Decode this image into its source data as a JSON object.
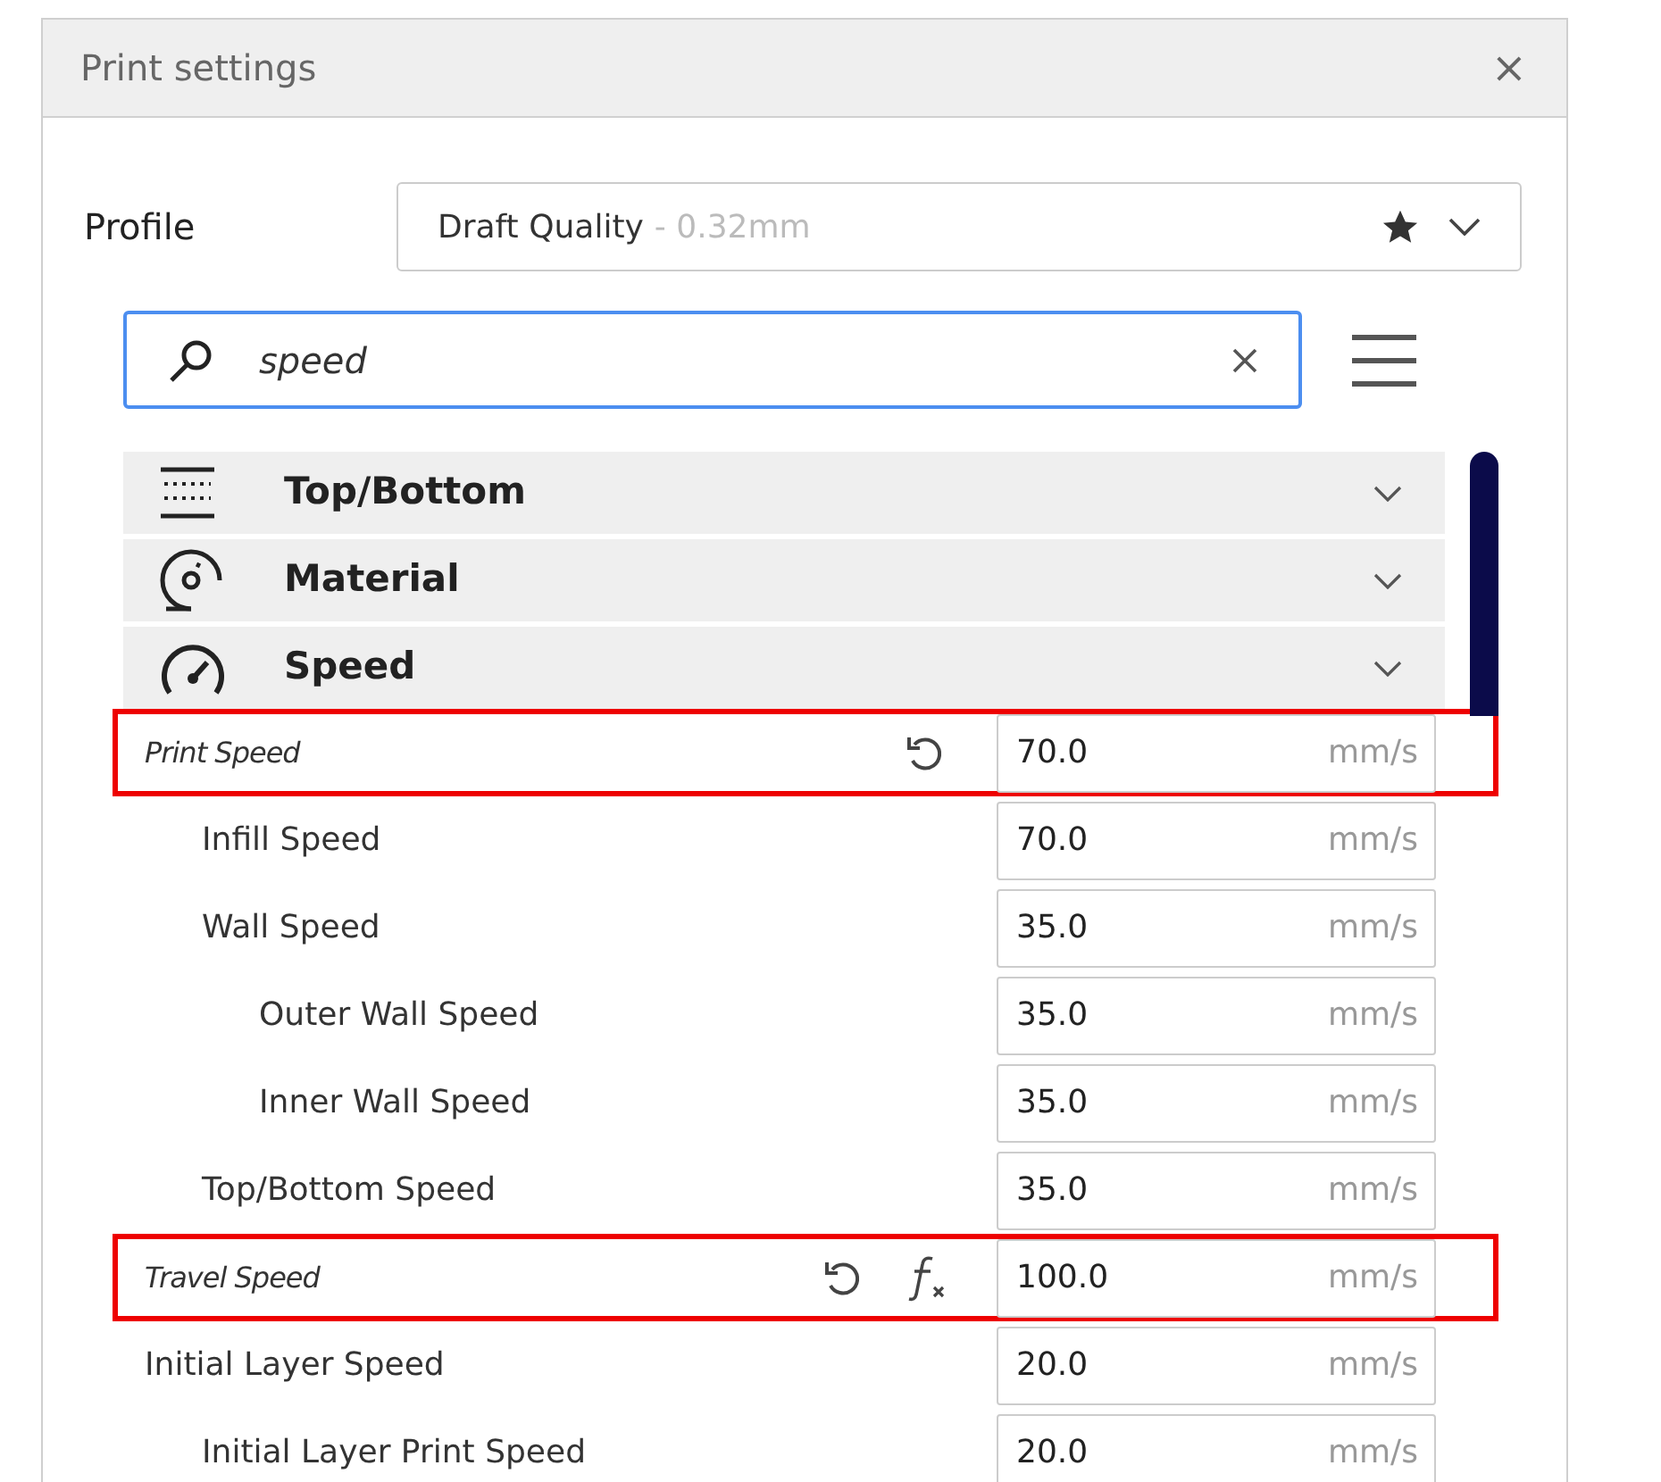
{
  "window": {
    "title": "Print settings",
    "close": "×"
  },
  "profile": {
    "label": "Profile",
    "name": "Draft Quality",
    "detail": "- 0.32mm"
  },
  "search": {
    "value": "speed"
  },
  "categories": [
    {
      "label": "Top/Bottom"
    },
    {
      "label": "Material"
    },
    {
      "label": "Speed"
    }
  ],
  "settings": [
    {
      "label": "Print Speed",
      "value": "70.0",
      "unit": "mm/s",
      "modified": true,
      "formula": false,
      "highlighted": true,
      "children": [
        {
          "label": "Infill Speed",
          "value": "70.0",
          "unit": "mm/s",
          "modified": false,
          "formula": false,
          "highlighted": false
        },
        {
          "label": "Wall Speed",
          "value": "35.0",
          "unit": "mm/s",
          "modified": false,
          "formula": false,
          "highlighted": false,
          "children": [
            {
              "label": "Outer Wall Speed",
              "value": "35.0",
              "unit": "mm/s",
              "modified": false,
              "formula": false,
              "highlighted": false
            },
            {
              "label": "Inner Wall Speed",
              "value": "35.0",
              "unit": "mm/s",
              "modified": false,
              "formula": false,
              "highlighted": false
            }
          ]
        },
        {
          "label": "Top/Bottom Speed",
          "value": "35.0",
          "unit": "mm/s",
          "modified": false,
          "formula": false,
          "highlighted": false
        }
      ]
    },
    {
      "label": "Travel Speed",
      "value": "100.0",
      "unit": "mm/s",
      "modified": true,
      "formula": true,
      "highlighted": true
    },
    {
      "label": "Initial Layer Speed",
      "value": "20.0",
      "unit": "mm/s",
      "modified": false,
      "formula": false,
      "highlighted": false,
      "children": [
        {
          "label": "Initial Layer Print Speed",
          "value": "20.0",
          "unit": "mm/s",
          "modified": false,
          "formula": false,
          "highlighted": false
        }
      ]
    }
  ]
}
